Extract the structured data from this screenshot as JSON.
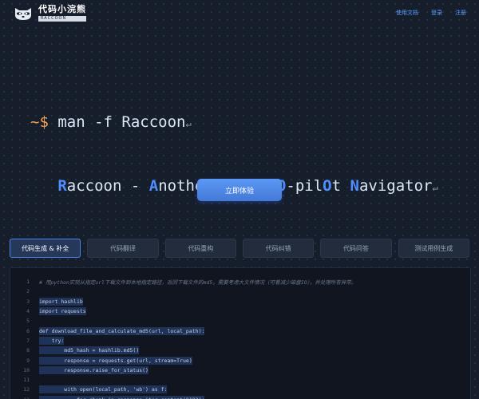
{
  "header": {
    "logo_title": "代码小浣熊",
    "logo_subtitle": "RACCOON",
    "logo_icon": "raccoon-icon",
    "nav": [
      "使用文档",
      "登录",
      "注册"
    ]
  },
  "terminal": {
    "prompt": "~$",
    "line1": "man -f Raccoon",
    "line2": {
      "r": "R",
      "r_rest": "accoon - ",
      "a": "A",
      "a_rest": "nother ",
      "c": "C",
      "c_rest": "ode ",
      "co": "CO",
      "co_rest": "-pil",
      "o": "O",
      "o_rest": "t ",
      "n": "N",
      "n_rest": "avigator"
    },
    "return_glyph": "↵",
    "cursor": ""
  },
  "cta_label": "立即体验",
  "tabs": [
    {
      "label": "代码生成 & 补全",
      "active": true
    },
    {
      "label": "代码翻译",
      "active": false
    },
    {
      "label": "代码重构",
      "active": false
    },
    {
      "label": "代码纠错",
      "active": false
    },
    {
      "label": "代码问答",
      "active": false
    },
    {
      "label": "测试用例生成",
      "active": false
    }
  ],
  "code": [
    {
      "n": "1",
      "text": "# 用python实现从指定url下载文件到本地指定路径，返回下载文件的md5，需要考虑大文件情况（可看减少磁盘IO），并处理所有异常。",
      "comment": true
    },
    {
      "n": "2",
      "text": ""
    },
    {
      "n": "3",
      "text": "import hashlib"
    },
    {
      "n": "4",
      "text": "import requests"
    },
    {
      "n": "5",
      "text": ""
    },
    {
      "n": "6",
      "text": "def download_file_and_calculate_md5(url, local_path):"
    },
    {
      "n": "7",
      "text": "    try:"
    },
    {
      "n": "8",
      "text": "        md5_hash = hashlib.md5()"
    },
    {
      "n": "9",
      "text": "        response = requests.get(url, stream=True)"
    },
    {
      "n": "10",
      "text": "        response.raise_for_status()"
    },
    {
      "n": "11",
      "text": ""
    },
    {
      "n": "12",
      "text": "        with open(local_path, 'wb') as f:"
    },
    {
      "n": "13",
      "text": "            for chunk in response.iter_content(8192):"
    }
  ],
  "colors": {
    "accent": "#4f8eff",
    "prompt": "#f5a04e",
    "background": "#161d2b"
  }
}
